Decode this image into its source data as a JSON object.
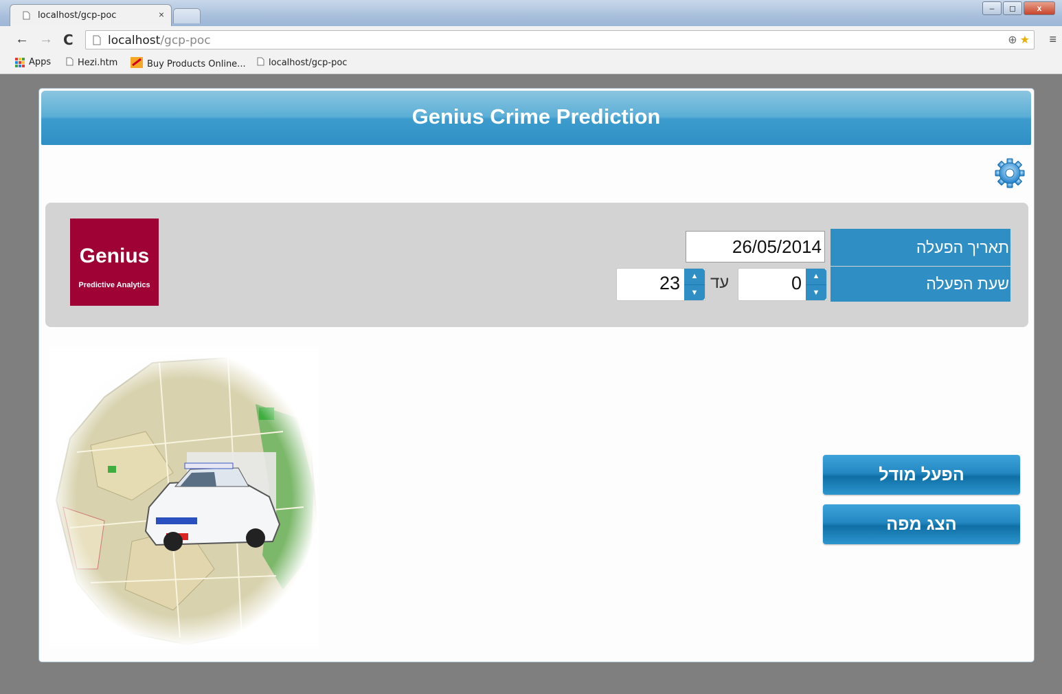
{
  "browser": {
    "tab_title": "localhost/gcp-poc",
    "tab_close": "×",
    "url_host": "localhost",
    "url_path": "/gcp-poc",
    "nav": {
      "back": "←",
      "forward": "→",
      "reload": "C"
    },
    "window_buttons": {
      "minimize": "–",
      "maximize": "◻",
      "close": "x"
    },
    "menu_icon": "≡",
    "bookmarks": [
      {
        "label": "Apps",
        "icon": "apps-grid-icon"
      },
      {
        "label": "Hezi.htm",
        "icon": "page-icon"
      },
      {
        "label": "Buy Products Online...",
        "icon": "aliexpress-icon"
      },
      {
        "label": "localhost/gcp-poc",
        "icon": "page-icon"
      }
    ]
  },
  "app": {
    "title": "Genius Crime Prediction",
    "logo": {
      "name": "Genius",
      "tagline": "Predictive Analytics",
      "color": "#9f0335"
    },
    "accent_color": "#2f8fc5",
    "form": {
      "date_label": "תאריך הפעלה",
      "date_value": "26/05/2014",
      "time_label": "שעת הפעלה",
      "time_from": "0",
      "time_to_label": "עד",
      "time_to": "23"
    },
    "buttons": {
      "run_model": "הפעל מודל",
      "show_map": "הצג מפה"
    }
  }
}
